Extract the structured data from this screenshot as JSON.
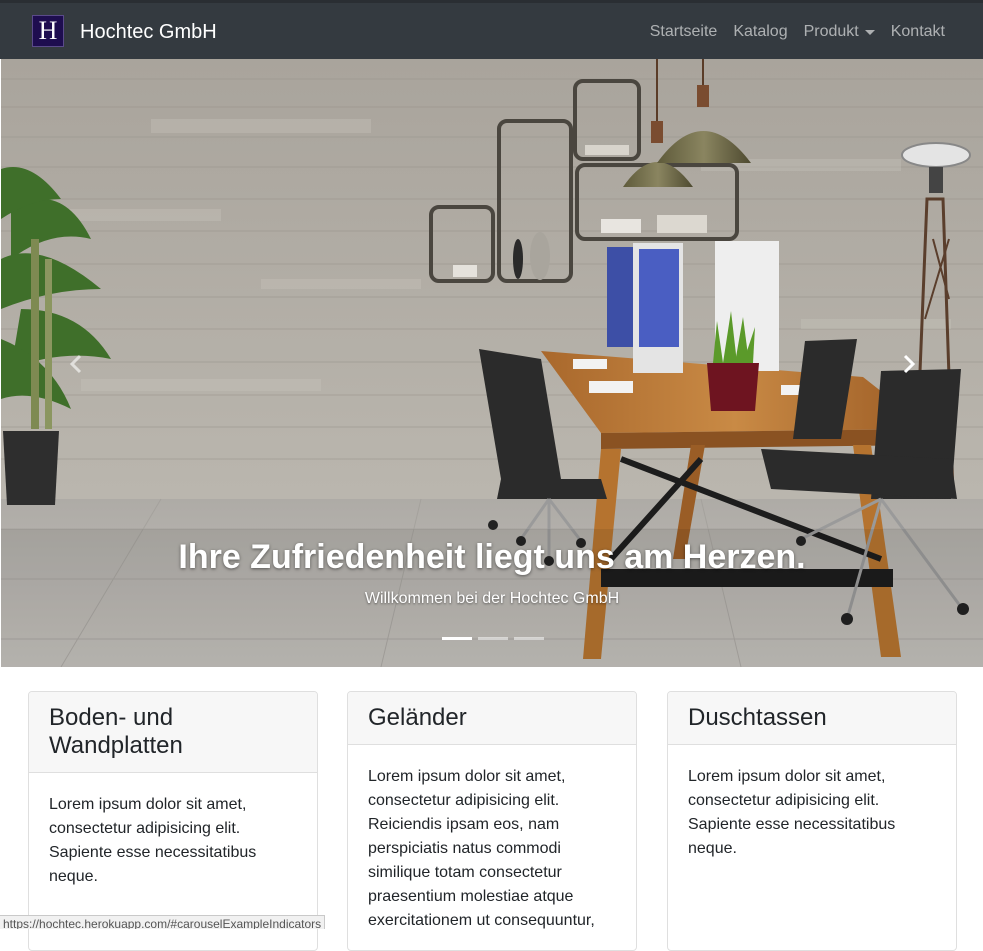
{
  "navbar": {
    "logo_letter": "H",
    "brand": "Hochtec GmbH",
    "links": [
      {
        "label": "Startseite"
      },
      {
        "label": "Katalog"
      },
      {
        "label": "Produkt"
      },
      {
        "label": "Kontakt"
      }
    ]
  },
  "carousel": {
    "title": "Ihre Zufriedenheit liegt uns am Herzen.",
    "subtitle": "Willkommen bei der Hochtec GmbH",
    "slide_count": 3,
    "active_slide": 1
  },
  "cards": [
    {
      "title": "Boden- und Wandplatten",
      "text": "Lorem ipsum dolor sit amet, consectetur adipisicing elit. Sapiente esse necessitatibus neque."
    },
    {
      "title": "Geländer",
      "text": "Lorem ipsum dolor sit amet, consectetur adipisicing elit. Reiciendis ipsam eos, nam perspiciatis natus commodi similique totam consectetur praesentium molestiae atque exercitationem ut consequuntur,"
    },
    {
      "title": "Duschtassen",
      "text": "Lorem ipsum dolor sit amet, consectetur adipisicing elit. Sapiente esse necessitatibus neque."
    }
  ],
  "statusbar": {
    "url": "https://hochtec.herokuapp.com/#carouselExampleIndicators"
  },
  "colors": {
    "navbar_bg": "#343a40",
    "logo_bg": "#1e0d4f",
    "card_header_bg": "#f7f7f7"
  }
}
